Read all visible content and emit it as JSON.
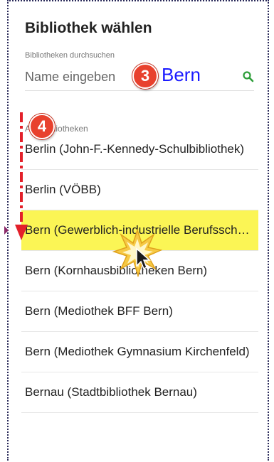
{
  "dialog": {
    "title": "Bibliothek wählen"
  },
  "search": {
    "label": "Bibliotheken durchsuchen",
    "placeholder": "Name eingeben",
    "icon": "search-icon"
  },
  "annotations": {
    "step3_number": "3",
    "step3_text": "Bern",
    "step4_number": "4"
  },
  "list": {
    "section_label": "Alle Bibliotheken",
    "items": [
      "Berlin (John-F.-Kennedy-Schulbibliothek)",
      "Berlin (VÖBB)",
      "Bern (Gewerblich-industrielle Berufsschule)",
      "Bern (Kornhausbibliotheken Bern)",
      "Bern (Mediothek BFF Bern)",
      "Bern (Mediothek Gymnasium Kirchenfeld)",
      "Bernau (Stadtbibliothek Bernau)"
    ],
    "highlighted_index": 2
  },
  "colors": {
    "highlight": "#fbf555",
    "annotation_red": "#e8412e",
    "typed_blue": "#1b1bff",
    "search_green": "#2e9e3a"
  }
}
